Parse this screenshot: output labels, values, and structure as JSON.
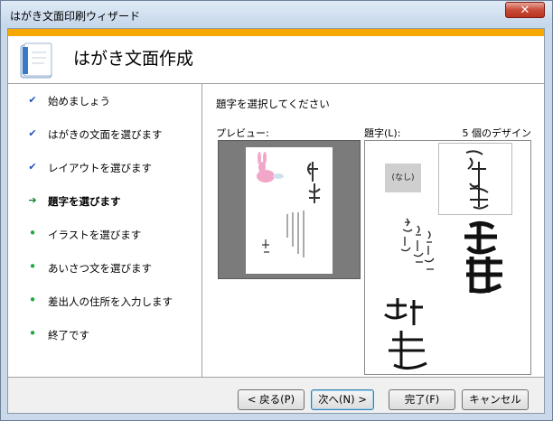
{
  "window": {
    "title": "はがき文面印刷ウィザード",
    "close_glyph": "✕"
  },
  "header": {
    "title": "はがき文面作成"
  },
  "steps": [
    {
      "label": "始めましょう",
      "state": "done",
      "glyph": "✔"
    },
    {
      "label": "はがきの文面を選びます",
      "state": "done",
      "glyph": "✔"
    },
    {
      "label": "レイアウトを選びます",
      "state": "done",
      "glyph": "✔"
    },
    {
      "label": "題字を選びます",
      "state": "current",
      "glyph": "➔"
    },
    {
      "label": "イラストを選びます",
      "state": "pending",
      "glyph": "•"
    },
    {
      "label": "あいさつ文を選びます",
      "state": "pending",
      "glyph": "•"
    },
    {
      "label": "差出人の住所を入力します",
      "state": "pending",
      "glyph": "•"
    },
    {
      "label": "終了です",
      "state": "pending",
      "glyph": "•"
    }
  ],
  "content": {
    "prompt": "題字を選択してください",
    "preview_label": "プレビュー:",
    "list_label": "題字(L):",
    "design_count": "5 個のデザイン",
    "none_option": "(なし)"
  },
  "buttons": {
    "back": "< 戻る(P)",
    "next": "次へ(N) >",
    "finish": "完了(F)",
    "cancel": "キャンセル"
  },
  "colors": {
    "accent": "#f7a800",
    "close": "#c94a38"
  }
}
